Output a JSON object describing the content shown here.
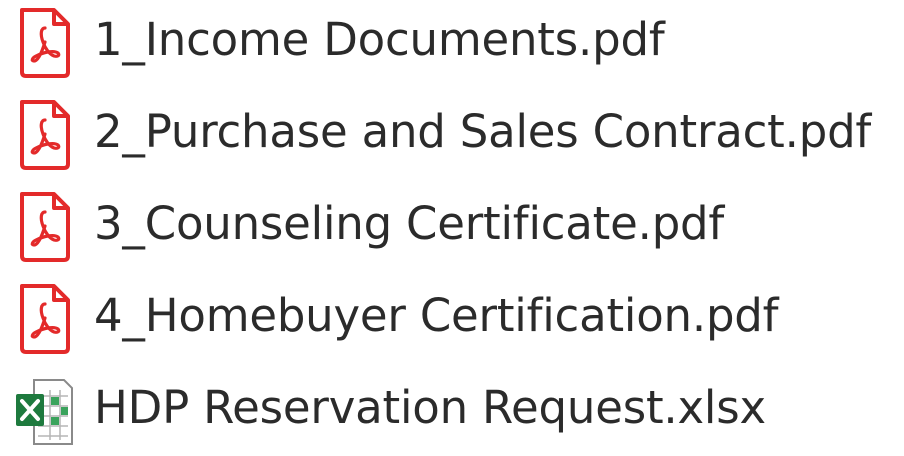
{
  "files": [
    {
      "name": "1_Income Documents.pdf",
      "icon": "pdf-icon"
    },
    {
      "name": "2_Purchase and Sales Contract.pdf",
      "icon": "pdf-icon"
    },
    {
      "name": "3_Counseling Certificate.pdf",
      "icon": "pdf-icon"
    },
    {
      "name": "4_Homebuyer Certification.pdf",
      "icon": "pdf-icon"
    },
    {
      "name": "HDP Reservation Request.xlsx",
      "icon": "excel-icon"
    }
  ],
  "colors": {
    "pdf_red": "#e32a2a",
    "excel_green": "#1e7a3e",
    "text": "#2b2b2b"
  }
}
